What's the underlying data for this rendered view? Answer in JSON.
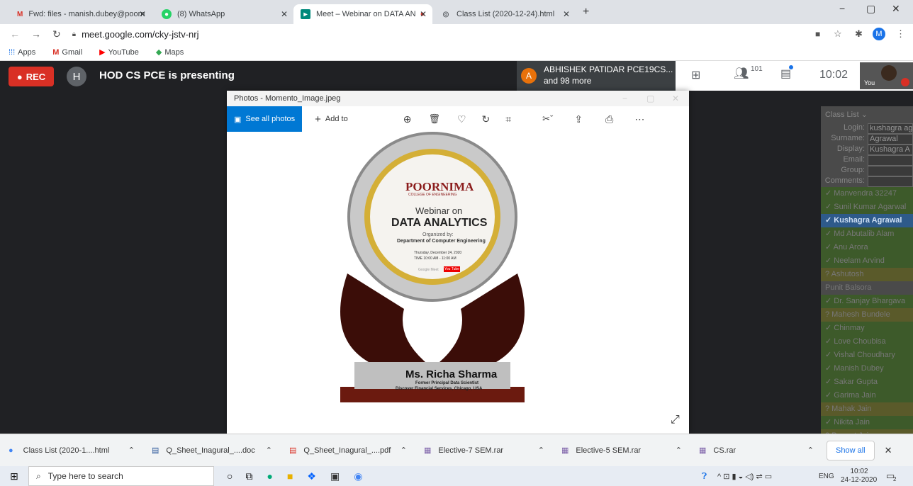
{
  "browser": {
    "tabs": [
      {
        "label": "Fwd: files - manish.dubey@poorn"
      },
      {
        "label": "(8) WhatsApp"
      },
      {
        "label": "Meet – Webinar on DATA AN"
      },
      {
        "label": "Class List (2020-12-24).html"
      }
    ],
    "url": "meet.google.com/cky-jstv-nrj",
    "bookmarks": [
      "Apps",
      "Gmail",
      "YouTube",
      "Maps"
    ],
    "profile_initial": "M"
  },
  "meet": {
    "rec_label": "REC",
    "presenter_initial": "H",
    "presenting_text": "HOD CS PCE is presenting",
    "participant_initial": "A",
    "participant_name": "ABHISHEK PATIDAR PCE19CS...",
    "participant_more": "and 98 more",
    "people_count": "101",
    "time": "10:02",
    "self_label": "You"
  },
  "photos": {
    "title": "Photos - Momento_Image.jpeg",
    "see_all": "See all photos",
    "add_to": "Add to",
    "memento": {
      "college": "POORNIMA",
      "college_sub": "COLLEGE OF ENGINEERING",
      "line1": "Webinar on",
      "line2": "DATA ANALYTICS",
      "organized": "Organized by:",
      "dept": "Department of Computer Engineering",
      "date": "Thursday, December 24, 2020",
      "time": "TIME 10:00 AM - 11:00 AM",
      "platform": "Google Meet",
      "yt": "You Tube",
      "name": "Ms. Richa Sharma",
      "role": "Former Principal Data Scientist",
      "org": "Discover Financial Services, Chicago, USA"
    }
  },
  "classlist": {
    "title": "Class List",
    "fields": [
      {
        "label": "Login:",
        "value": "kushagra ag"
      },
      {
        "label": "Surname:",
        "value": "Agrawal"
      },
      {
        "label": "Display:",
        "value": "Kushagra A"
      },
      {
        "label": "Email:",
        "value": ""
      },
      {
        "label": "Group:",
        "value": ""
      },
      {
        "label": "Comments:",
        "value": ""
      }
    ],
    "students": [
      {
        "name": "✓ Manvendra 32247",
        "color": "#3d5a2a"
      },
      {
        "name": "✓ Sunil Kumar Agarwal",
        "color": "#3d5a2a"
      },
      {
        "name": "✓ Kushagra Agrawal",
        "color": "#2e5a8a"
      },
      {
        "name": "✓ Md Abutalib Alam",
        "color": "#3d5a2a"
      },
      {
        "name": "✓ Anu Arora",
        "color": "#3d5a2a"
      },
      {
        "name": "✓ Neelam Arvind",
        "color": "#3d5a2a"
      },
      {
        "name": "? Ashutosh",
        "color": "#5a5a2a"
      },
      {
        "name": "Punit Balsora",
        "color": "#4a4a4a"
      },
      {
        "name": "✓ Dr. Sanjay Bhargava",
        "color": "#3d5a2a"
      },
      {
        "name": "? Mahesh Bundele",
        "color": "#5a5a2a"
      },
      {
        "name": "✓ Chinmay",
        "color": "#3d5a2a"
      },
      {
        "name": "✓ Love Choubisa",
        "color": "#3d5a2a"
      },
      {
        "name": "✓ Vishal Choudhary",
        "color": "#3d5a2a"
      },
      {
        "name": "✓ Manish Dubey",
        "color": "#3d5a2a"
      },
      {
        "name": "✓ Sakar Gupta",
        "color": "#3d5a2a"
      },
      {
        "name": "✓ Garima Jain",
        "color": "#3d5a2a"
      },
      {
        "name": "? Mahak Jain",
        "color": "#5a5a2a"
      },
      {
        "name": "✓ Nikita Jain",
        "color": "#3d5a2a"
      },
      {
        "name": "? Puneet Jain",
        "color": "#5a5a2a"
      }
    ]
  },
  "downloads": {
    "items": [
      {
        "label": "Class List (2020-1....html"
      },
      {
        "label": "Q_Sheet_Inagural_....doc"
      },
      {
        "label": "Q_Sheet_Inagural_....pdf"
      },
      {
        "label": "Elective-7 SEM.rar"
      },
      {
        "label": "Elective-5 SEM.rar"
      },
      {
        "label": "CS.rar"
      }
    ],
    "show_all": "Show all"
  },
  "taskbar": {
    "search_placeholder": "Type here to search",
    "lang": "ENG",
    "time": "10:02",
    "date": "24-12-2020",
    "notif": "2"
  }
}
